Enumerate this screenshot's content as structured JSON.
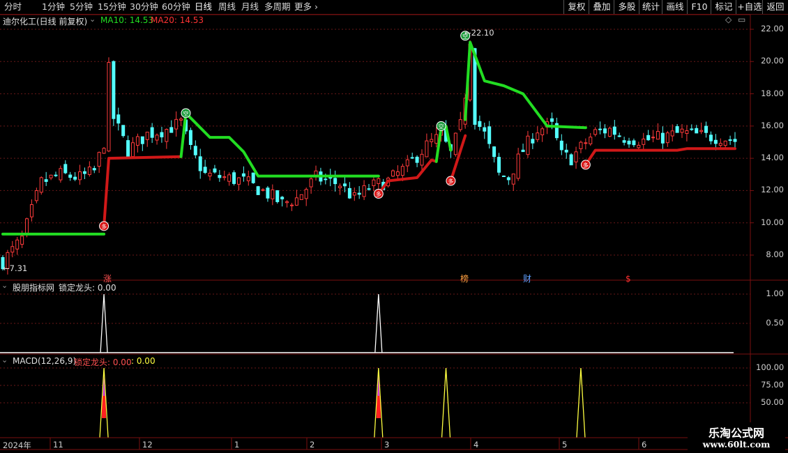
{
  "toolbar": {
    "periods": [
      "分时",
      "1分钟",
      "5分钟",
      "15分钟",
      "30分钟",
      "60分钟",
      "日线",
      "周线",
      "月线",
      "多周期"
    ],
    "active_period": "日线",
    "more": "更多",
    "right_buttons": [
      "复权",
      "叠加",
      "多股",
      "统计",
      "画线",
      "F10",
      "标记",
      "+自选",
      "返回"
    ]
  },
  "main_panel": {
    "stock_name": "迪尔化工(日线 前复权)",
    "ma10_label": "MA10: 14.53",
    "ma20_label": "MA20: 14.53",
    "high_label": "22.10",
    "low_label": "7.31",
    "buy_glyph": "多",
    "sell_glyph": "空",
    "tag_marks": [
      {
        "text": "涨",
        "color": "#ff5050"
      },
      {
        "text": "榜",
        "color": "#ffa040"
      },
      {
        "text": "财",
        "color": "#60a0ff"
      },
      {
        "text": "$",
        "color": "#ff3030"
      }
    ]
  },
  "panel2": {
    "name": "股朋指标网",
    "series_label": "锁定龙头: 0.00"
  },
  "panel3": {
    "name": "MACD(12,26,9)",
    "series_label": "锁定龙头: 0.00",
    "value2": ": 0.00"
  },
  "x_axis": {
    "labels": [
      "2024年",
      "11",
      "12",
      "1",
      "2",
      "3",
      "4",
      "5",
      "6"
    ]
  },
  "watermark": {
    "line1": "乐淘公式网",
    "line2": "www.60lt.com"
  },
  "chart_data": [
    {
      "type": "candlestick",
      "title": "迪尔化工(日线 前复权)",
      "y_ticks": [
        8.0,
        10.0,
        12.0,
        14.0,
        16.0,
        18.0,
        20.0,
        22.0
      ],
      "ylim": [
        7.2,
        22.4
      ],
      "price_high": 22.1,
      "price_low": 7.31,
      "ma10": 14.53,
      "ma20": 14.53,
      "x_months": [
        "2024年",
        "11",
        "12",
        "1",
        "2",
        "3",
        "4",
        "5",
        "6"
      ],
      "support_line": {
        "segments": [
          {
            "color": "#22dd22",
            "points": [
              [
                0,
                9.3
              ],
              [
                21,
                9.3
              ]
            ]
          },
          {
            "color": "#d01818",
            "points": [
              [
                21,
                9.8
              ],
              [
                22,
                14.0
              ],
              [
                37,
                14.1
              ]
            ]
          },
          {
            "color": "#22dd22",
            "points": [
              [
                37,
                14.1
              ],
              [
                38,
                16.8
              ],
              [
                40,
                16.2
              ],
              [
                43,
                15.3
              ],
              [
                47,
                15.3
              ],
              [
                50,
                14.4
              ],
              [
                53,
                12.9
              ],
              [
                78,
                12.9
              ]
            ]
          },
          {
            "color": "#d01818",
            "points": [
              [
                78,
                11.8
              ],
              [
                80,
                12.6
              ],
              [
                86,
                12.8
              ],
              [
                89,
                13.9
              ],
              [
                90,
                13.8
              ]
            ]
          },
          {
            "color": "#22dd22",
            "points": [
              [
                90,
                13.8
              ],
              [
                91,
                15.9
              ],
              [
                92,
                16.0
              ],
              [
                93,
                14.5
              ]
            ]
          },
          {
            "color": "#d01818",
            "points": [
              [
                93,
                12.6
              ],
              [
                96,
                15.4
              ]
            ]
          },
          {
            "color": "#22dd22",
            "points": [
              [
                96,
                16.4
              ],
              [
                97,
                21.2
              ],
              [
                98,
                20.4
              ],
              [
                100,
                18.8
              ],
              [
                104,
                18.5
              ],
              [
                108,
                18.0
              ],
              [
                113,
                16.0
              ],
              [
                121,
                15.9
              ]
            ]
          },
          {
            "color": "#d01818",
            "points": [
              [
                121,
                13.6
              ],
              [
                123,
                14.5
              ],
              [
                140,
                14.5
              ],
              [
                142,
                14.6
              ],
              [
                152,
                14.6
              ]
            ]
          }
        ],
        "buy_signals": [
          [
            21,
            9.8
          ],
          [
            78,
            11.8
          ],
          [
            93,
            12.6
          ],
          [
            121,
            13.6
          ]
        ],
        "sell_signals": [
          [
            38,
            16.8
          ],
          [
            91,
            16.0
          ],
          [
            96,
            21.6
          ]
        ]
      }
    },
    {
      "type": "area",
      "title": "股朋指标网",
      "series": [
        {
          "name": "锁定龙头",
          "spikes_at": [
            21,
            78
          ],
          "values": [
            1.0,
            1.0
          ]
        }
      ],
      "y_ticks": [
        0.5,
        1.0
      ],
      "ylim": [
        0,
        1.15
      ]
    },
    {
      "type": "area",
      "title": "MACD(12,26,9)",
      "series": [
        {
          "name": "锁定龙头",
          "spikes_at": [
            21,
            78,
            92,
            120
          ],
          "values": [
            100,
            100,
            100,
            100
          ]
        }
      ],
      "y_ticks": [
        50.0,
        75.0,
        100.0
      ],
      "ylim": [
        35,
        110
      ]
    }
  ]
}
